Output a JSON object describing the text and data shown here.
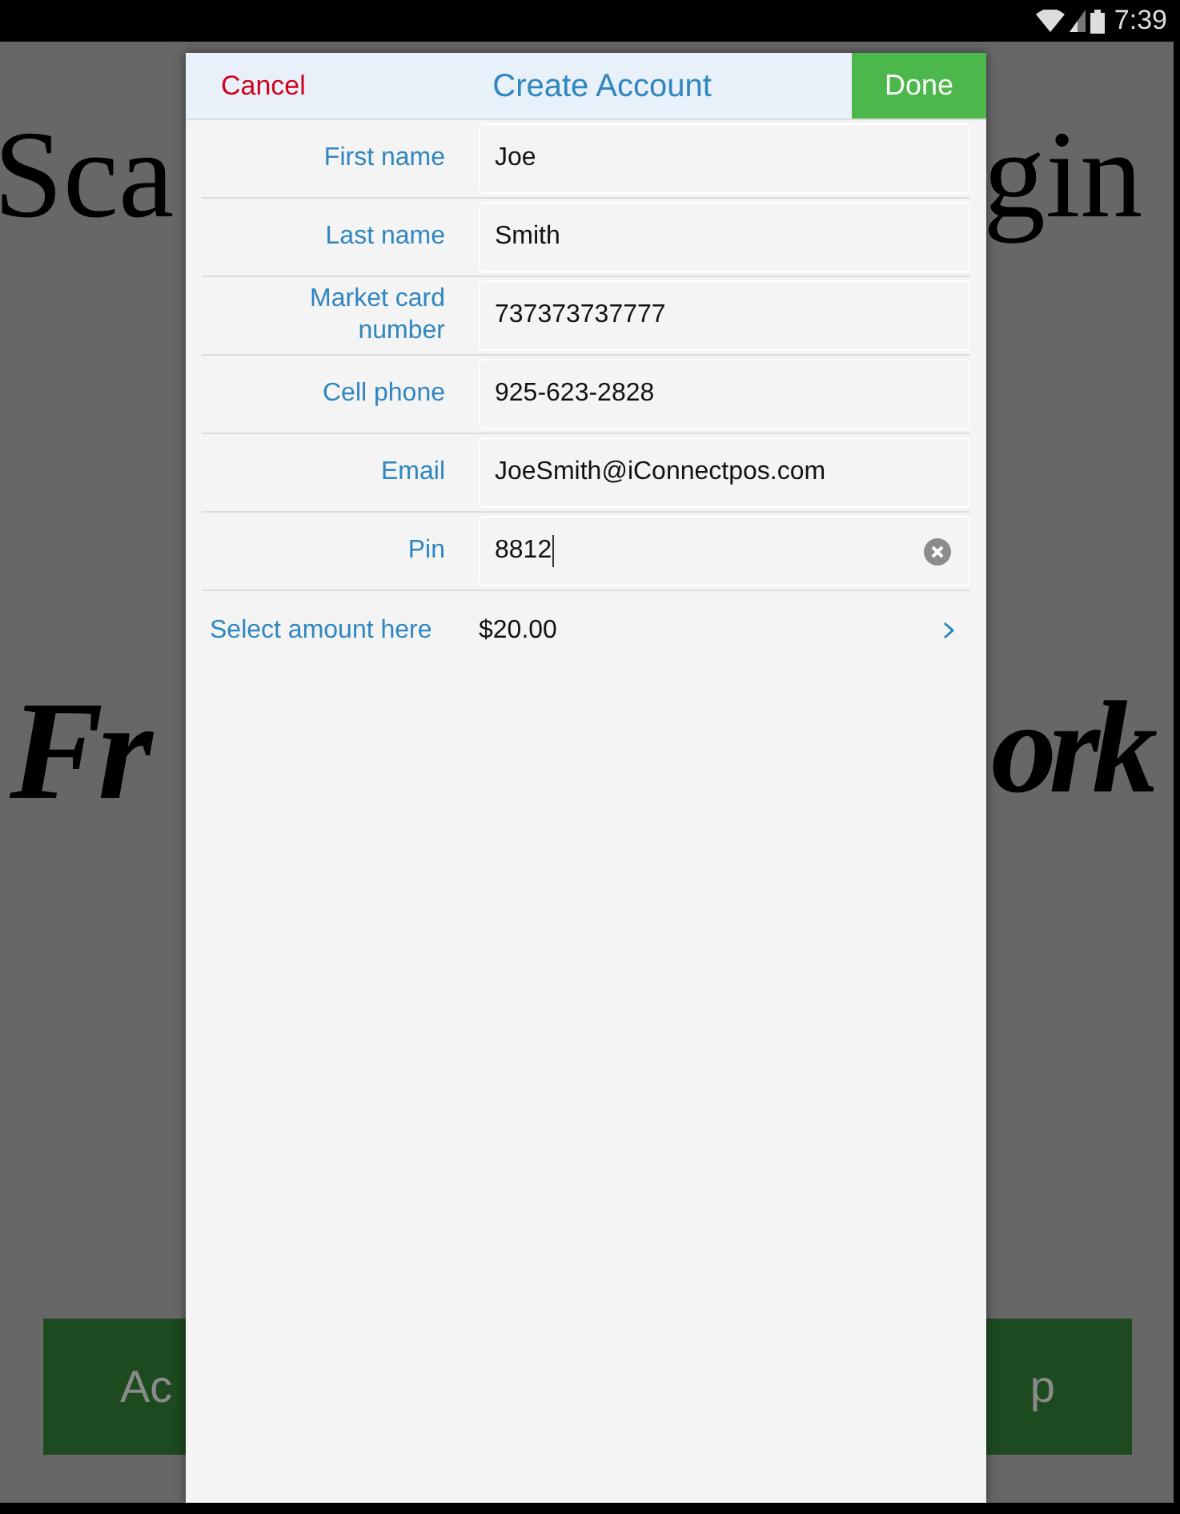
{
  "status_bar": {
    "time": "7:39"
  },
  "background": {
    "heading_left": "Sca",
    "heading_right": "gin",
    "script_left": "Fr",
    "script_right": "ork",
    "button_left": "Ac",
    "button_right": "p"
  },
  "dialog": {
    "cancel": "Cancel",
    "title": "Create Account",
    "done": "Done",
    "fields": [
      {
        "label": "First name",
        "value": "Joe",
        "focused": false
      },
      {
        "label": "Last name",
        "value": "Smith",
        "focused": false
      },
      {
        "label": "Market card number",
        "value": "737373737777",
        "focused": false
      },
      {
        "label": "Cell phone",
        "value": "925-623-2828",
        "focused": false
      },
      {
        "label": "Email",
        "value": "JoeSmith@iConnectpos.com",
        "focused": false
      },
      {
        "label": "Pin",
        "value": "8812",
        "focused": true
      }
    ],
    "amount": {
      "label": "Select amount here",
      "value": "$20.00"
    }
  }
}
